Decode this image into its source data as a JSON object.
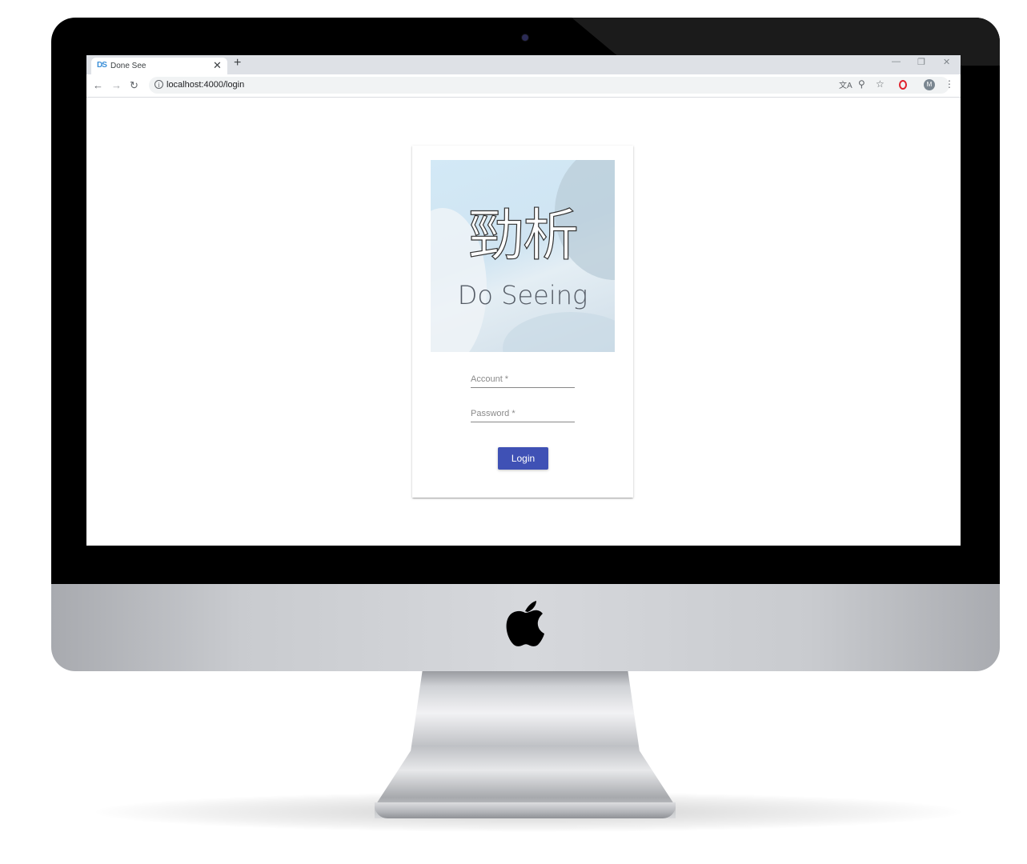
{
  "browser": {
    "tab_title": "Done See",
    "tab_favicon": "DS",
    "url": "localhost:4000/login",
    "profile_initial": "M"
  },
  "icons": {
    "back": "back-arrow-icon",
    "forward": "forward-arrow-icon",
    "reload": "reload-icon",
    "info": "info-icon",
    "translate": "translate-icon",
    "zoom": "zoom-icon",
    "star": "bookmark-star-icon",
    "opera": "opera-icon",
    "menu": "kebab-menu-icon",
    "device_logo": "apple-icon"
  },
  "login": {
    "brand_title_cn": "勁析",
    "brand_title_en": "Do Seeing",
    "account_label": "Account *",
    "password_label": "Password *",
    "login_button": "Login"
  },
  "colors": {
    "primary_button": "#3f51b5",
    "brand_background": "#d3e9f6"
  }
}
